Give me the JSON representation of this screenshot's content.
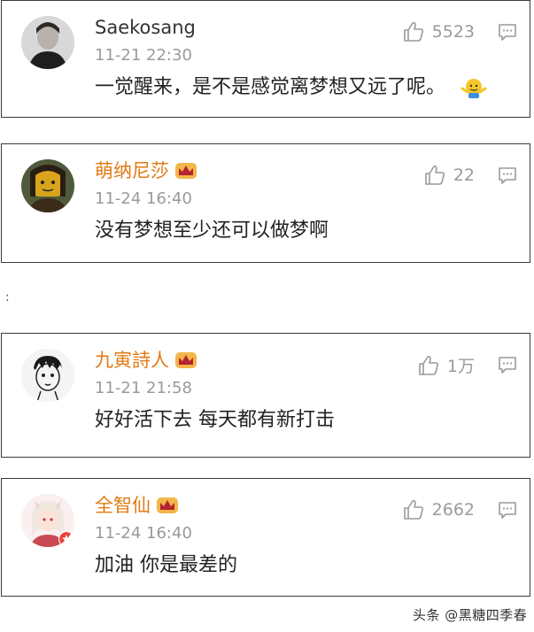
{
  "comments": [
    {
      "username": "Saekosang",
      "timestamp": "11-21 22:30",
      "text": "一觉醒来，是不是感觉离梦想又远了呢。",
      "likes": "5523",
      "vip": false,
      "avatar": "man-portrait-icon",
      "emoji": "shrug-emoji-icon"
    },
    {
      "username": "萌纳尼莎",
      "timestamp": "11-24 16:40",
      "text": "没有梦想至少还可以做梦啊",
      "likes": "22",
      "vip": true,
      "avatar": "mona-lisa-lego-icon"
    },
    {
      "username": "九寅詩人",
      "timestamp": "11-21 21:58",
      "text": "好好活下去 每天都有新打击",
      "likes": "1万",
      "vip": true,
      "avatar": "sketch-face-icon"
    },
    {
      "username": "全智仙",
      "timestamp": "11-24 16:40",
      "text": "加油 你是最差的",
      "likes": "2662",
      "vip": true,
      "avatar": "anime-girl-icon"
    }
  ],
  "separator": ":",
  "watermark": "头条 @黑糖四季春",
  "colors": {
    "vip_name": "#e07a13",
    "meta": "#9a9a9a",
    "border": "#3a3a3a"
  }
}
